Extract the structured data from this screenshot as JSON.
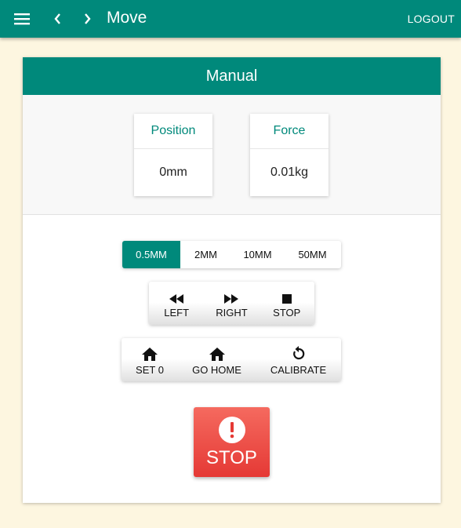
{
  "appbar": {
    "title": "Move",
    "logout_label": "LOGOUT",
    "icons": {
      "menu": "menu-icon",
      "back": "chevron-left-icon",
      "forward": "chevron-right-icon"
    }
  },
  "card": {
    "title": "Manual",
    "position": {
      "label": "Position",
      "value": "0mm"
    },
    "force": {
      "label": "Force",
      "value": "0.01kg"
    },
    "step_sizes": {
      "options": [
        "0.5MM",
        "2MM",
        "10MM",
        "50MM"
      ],
      "selected": "0.5MM"
    },
    "move_buttons": [
      {
        "label": "LEFT",
        "icon": "fast-rewind-icon"
      },
      {
        "label": "RIGHT",
        "icon": "fast-forward-icon"
      },
      {
        "label": "STOP",
        "icon": "stop-square-icon"
      }
    ],
    "home_buttons": [
      {
        "label": "SET 0",
        "icon": "home-icon"
      },
      {
        "label": "GO HOME",
        "icon": "home-icon"
      },
      {
        "label": "CALIBRATE",
        "icon": "refresh-icon"
      }
    ],
    "emergency_stop": {
      "label": "STOP",
      "icon": "alert-circle-icon"
    }
  },
  "colors": {
    "primary": "#00897b",
    "background": "#fdf6e0",
    "danger": "#e53935"
  }
}
